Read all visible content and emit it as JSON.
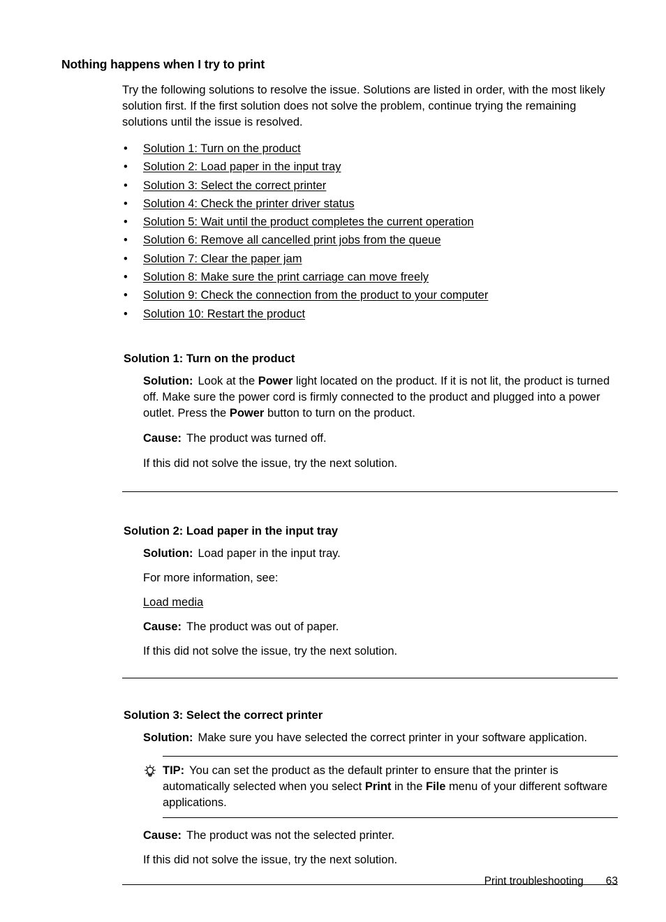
{
  "page": {
    "title": "Nothing happens when I try to print",
    "intro": "Try the following solutions to resolve the issue. Solutions are listed in order, with the most likely solution first. If the first solution does not solve the problem, continue trying the remaining solutions until the issue is resolved."
  },
  "toc": {
    "bullet": "•",
    "items": [
      "Solution 1: Turn on the product",
      "Solution 2: Load paper in the input tray",
      "Solution 3: Select the correct printer",
      "Solution 4: Check the printer driver status",
      "Solution 5: Wait until the product completes the current operation",
      "Solution 6: Remove all cancelled print jobs from the queue",
      "Solution 7: Clear the paper jam",
      "Solution 8: Make sure the print carriage can move freely",
      "Solution 9: Check the connection from the product to your computer",
      "Solution 10: Restart the product"
    ]
  },
  "labels": {
    "solution": "Solution:",
    "cause": "Cause:",
    "tip": "TIP:",
    "next_solution": "If this did not solve the issue, try the next solution.",
    "more_information": "For more information, see:"
  },
  "section1": {
    "title": "Solution 1: Turn on the product",
    "solution_1": "Look at the ",
    "solution_bold_1": "Power",
    "solution_2": " light located on the product. If it is not lit, the product is turned off. Make sure the power cord is firmly connected to the product and plugged into a power outlet. Press the ",
    "solution_bold_2": "Power",
    "solution_3": " button to turn on the product.",
    "cause": "The product was turned off.",
    "next": "If this did not solve the issue, try the next solution."
  },
  "section2": {
    "title": "Solution 2: Load paper in the input tray",
    "solution": "Load paper in the input tray.",
    "more_information": "For more information, see:",
    "link": "Load media",
    "cause": "The product was out of paper.",
    "next": "If this did not solve the issue, try the next solution."
  },
  "section3": {
    "title": "Solution 3: Select the correct printer",
    "solution": "Make sure you have selected the correct printer in your software application.",
    "tip_label": "TIP:",
    "tip_1": "You can set the product as the default printer to ensure that the printer is automatically selected when you select ",
    "tip_bold_1": "Print",
    "tip_2": " in the ",
    "tip_bold_2": "File",
    "tip_3": " menu of your different software applications.",
    "cause": "The product was not the selected printer.",
    "next": "If this did not solve the issue, try the next solution."
  },
  "footer": {
    "label": "Print troubleshooting",
    "page_number": "63"
  },
  "colors": {
    "text": "#000000",
    "background": "#ffffff",
    "rule": "#000000"
  },
  "icons": {
    "tip": "lightbulb-icon"
  }
}
